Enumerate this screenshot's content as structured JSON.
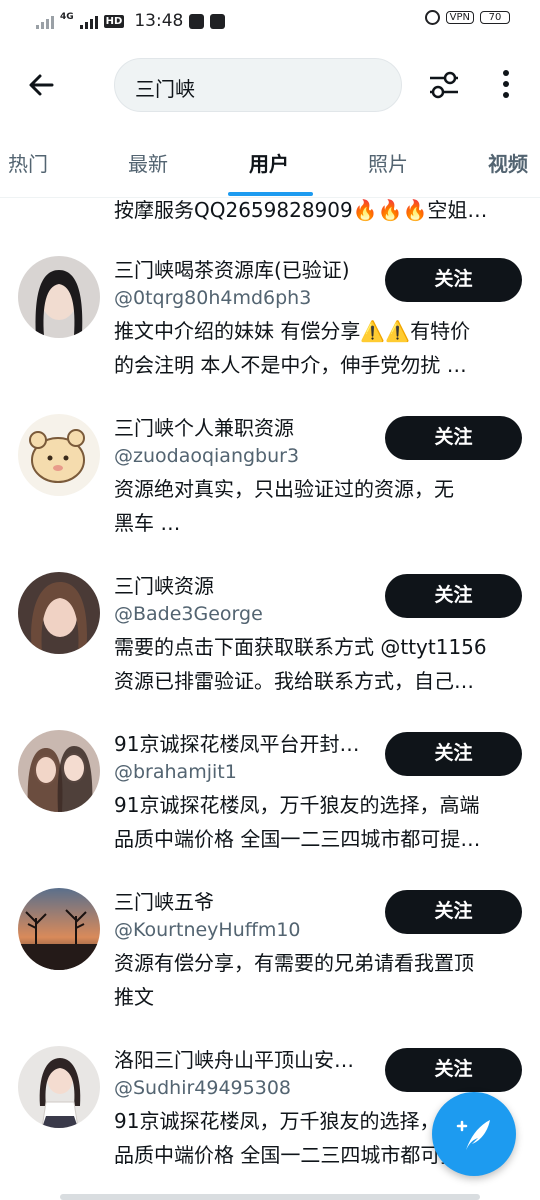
{
  "status_bar": {
    "network": "4G",
    "hd": "HD",
    "time": "13:48",
    "vpn": "VPN",
    "battery": "70"
  },
  "search": {
    "query": "三门峡"
  },
  "tabs": [
    {
      "label": "热门"
    },
    {
      "label": "最新"
    },
    {
      "label": "用户",
      "active": true
    },
    {
      "label": "照片"
    },
    {
      "label": "视频"
    }
  ],
  "partial_bio": "按摩服务QQ2659828909🔥🔥🔥空姐…",
  "users": [
    {
      "name": "三门峡喝茶资源库(已验证)",
      "handle": "@0tqrg80h4md6ph3",
      "bio": [
        "推文中介绍的妹妹 有偿分享⚠️⚠️有特价",
        "的会注明 本人不是中介，伸手党勿扰 …"
      ],
      "follow_label": "关注"
    },
    {
      "name": "三门峡个人兼职资源",
      "handle": "@zuodaoqiangbur3",
      "bio": [
        "资源绝对真实，只出验证过的资源，无",
        "黑车 …"
      ],
      "follow_label": "关注"
    },
    {
      "name": "三门峡资源",
      "handle": "@Bade3George",
      "bio": [
        "需要的点击下面获取联系方式 @ttyt1156",
        "资源已排雷验证。我给联系方式，自己…"
      ],
      "follow_label": "关注"
    },
    {
      "name": "91京诚探花楼凤平台开封…",
      "handle": "@brahamjit1",
      "bio": [
        "91京诚探花楼凤，万千狼友的选择，高端",
        "品质中端价格 全国一二三四城市都可提…"
      ],
      "follow_label": "关注"
    },
    {
      "name": "三门峡五爷",
      "handle": "@KourtneyHuffm10",
      "bio": [
        "资源有偿分享，有需要的兄弟请看我置顶",
        "推文"
      ],
      "follow_label": "关注"
    },
    {
      "name": "洛阳三门峡舟山平顶山安…",
      "handle": "@Sudhir49495308",
      "bio": [
        "91京诚探花楼凤，万千狼友的选择，高端",
        "品质中端价格 全国一二三四城市都可提…"
      ],
      "follow_label": "关注"
    }
  ],
  "colors": {
    "accent": "#1d9bf0",
    "follow_bg": "#0f1419",
    "secondary_text": "#536471"
  }
}
